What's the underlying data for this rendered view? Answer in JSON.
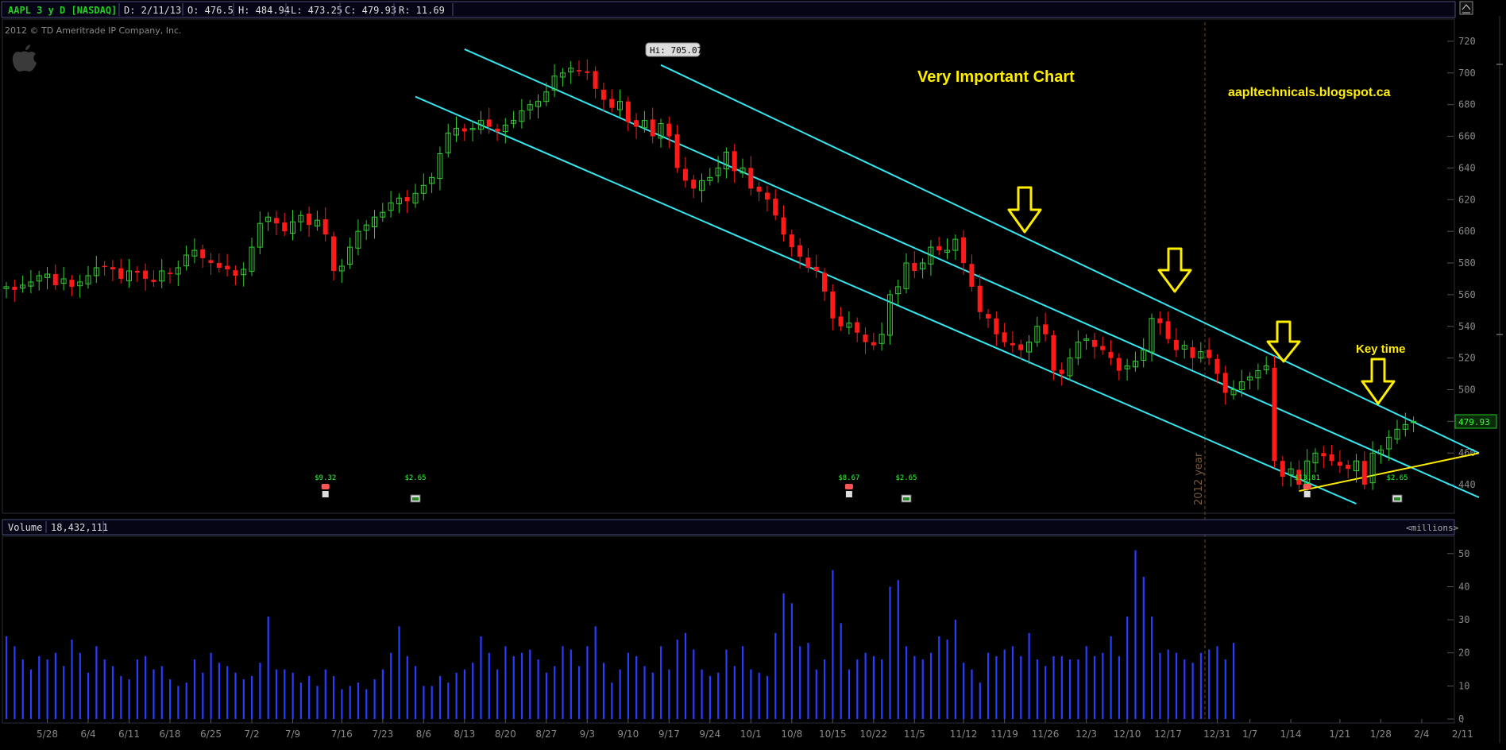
{
  "header": {
    "symbol": "AAPL 3 y D [NASDAQ]",
    "date": "D: 2/11/13",
    "open": "O: 476.5",
    "high": "H: 484.94",
    "low": "L: 473.25",
    "close": "C: 479.93",
    "range": "R: 11.69"
  },
  "copyright": "2012 © TD Ameritrade IP Company, Inc.",
  "annotations": {
    "title": "Very Important Chart",
    "blog": "aapltechnicals.blogspot.ca",
    "key_time": "Key time",
    "hi_label": "Hi: 705.07",
    "year_label": "2012 year",
    "last_price": "479.93"
  },
  "volume_header": {
    "label": "Volume",
    "value": "18,432,111",
    "units": "<millions>"
  },
  "events": [
    {
      "label": "$9.32",
      "icon": "earnings-phone-icon",
      "date_index": 39
    },
    {
      "label": "$2.65",
      "icon": "dividend-icon",
      "date_index": 50
    },
    {
      "label": "$8.67",
      "icon": "earnings-phone-icon",
      "date_index": 103
    },
    {
      "label": "$2.65",
      "icon": "dividend-icon",
      "date_index": 110
    },
    {
      "label": "$13.81",
      "icon": "earnings-phone-icon",
      "date_index": 159
    },
    {
      "label": "$2.65",
      "icon": "dividend-icon",
      "date_index": 170
    }
  ],
  "colors": {
    "up": "#33cc33",
    "down": "#ff1a1a",
    "channel": "#33e6f0",
    "trendline": "#ffee00",
    "arrow": "#ffee00",
    "volume": "#2a3cff",
    "grid_text": "#888888",
    "header_green": "#22cc22"
  },
  "chart_data": {
    "type": "candlestick",
    "price_axis": {
      "min": 425,
      "max": 730,
      "ticks": [
        440,
        460,
        480,
        500,
        520,
        540,
        560,
        580,
        600,
        620,
        640,
        660,
        680,
        700,
        720
      ]
    },
    "volume_axis": {
      "min": 0,
      "max": 55,
      "ticks": [
        0,
        10,
        20,
        30,
        40,
        50
      ]
    },
    "x_tick_labels": [
      "5/28",
      "6/4",
      "6/11",
      "6/18",
      "6/25",
      "7/2",
      "7/9",
      "7/16",
      "7/23",
      "8/6",
      "8/13",
      "8/20",
      "8/27",
      "9/3",
      "9/10",
      "9/17",
      "9/24",
      "10/1",
      "10/8",
      "10/15",
      "10/22",
      "11/5",
      "11/12",
      "11/19",
      "11/26",
      "12/3",
      "12/10",
      "12/17",
      "12/31",
      "1/7",
      "1/14",
      "1/21",
      "1/28",
      "2/4",
      "2/11"
    ],
    "x_tick_index": [
      5,
      10,
      15,
      20,
      25,
      30,
      35,
      41,
      46,
      51,
      56,
      61,
      66,
      71,
      76,
      81,
      86,
      91,
      96,
      101,
      106,
      111,
      117,
      122,
      127,
      132,
      137,
      142,
      148,
      152,
      157,
      163,
      168,
      173,
      178
    ],
    "series": [
      {
        "name": "AAPL",
        "values": [
          565,
          563,
          566,
          568,
          572,
          573,
          566,
          570,
          565,
          568,
          572,
          577,
          578,
          576,
          570,
          575,
          574,
          570,
          568,
          575,
          573,
          577,
          585,
          588,
          583,
          580,
          577,
          576,
          572,
          576,
          590,
          605,
          609,
          605,
          600,
          606,
          610,
          604,
          607,
          598,
          575,
          578,
          590,
          600,
          604,
          609,
          612,
          618,
          621,
          619,
          624,
          629,
          634,
          649,
          662,
          665,
          663,
          665,
          670,
          666,
          663,
          667,
          670,
          676,
          680,
          682,
          688,
          698,
          700,
          703,
          701,
          700,
          690,
          683,
          678,
          682,
          669,
          666,
          670,
          660,
          668,
          660,
          640,
          632,
          627,
          632,
          634,
          640,
          650,
          638,
          640,
          627,
          625,
          620,
          610,
          598,
          590,
          584,
          577,
          575,
          562,
          545,
          540,
          542,
          536,
          530,
          528,
          535,
          560,
          565,
          580,
          575,
          580,
          590,
          588,
          588,
          595,
          580,
          565,
          549,
          545,
          535,
          530,
          528,
          525,
          530,
          540,
          535,
          512,
          510,
          520,
          530,
          532,
          527,
          525,
          520,
          512,
          515,
          518,
          525,
          545,
          542,
          532,
          525,
          528,
          520,
          524,
          520,
          510,
          498,
          500,
          505,
          508,
          512,
          515,
          455,
          445,
          450,
          440,
          455,
          460,
          458,
          455,
          452,
          450,
          455,
          440,
          460,
          462,
          470,
          475,
          478,
          480
        ],
        "volume": [
          25,
          22,
          18,
          15,
          19,
          18,
          20,
          16,
          24,
          20,
          14,
          22,
          18,
          16,
          13,
          12,
          18,
          19,
          15,
          16,
          12,
          10,
          11,
          18,
          14,
          20,
          17,
          16,
          14,
          12,
          13,
          17,
          31,
          15,
          15,
          14,
          11,
          13,
          10,
          15,
          13,
          9,
          10,
          11,
          9,
          12,
          15,
          20,
          28,
          19,
          16,
          10,
          10,
          13,
          11,
          14,
          15,
          17,
          25,
          20,
          15,
          22,
          19,
          20,
          21,
          18,
          14,
          16,
          22,
          21,
          16,
          22,
          28,
          17,
          11,
          15,
          20,
          19,
          16,
          14,
          22,
          15,
          24,
          26,
          21,
          15,
          13,
          14,
          21,
          16,
          22,
          15,
          14,
          13,
          26,
          38,
          35,
          22,
          23,
          15,
          18,
          45,
          29,
          15,
          18,
          20,
          19,
          18,
          40,
          42,
          22,
          19,
          18,
          20,
          25,
          24,
          30,
          17,
          15,
          11,
          20,
          19,
          21,
          22,
          19,
          26,
          18,
          16,
          19,
          19,
          18,
          18,
          22,
          19,
          20,
          25,
          19,
          31,
          51,
          43,
          31,
          20,
          21,
          20,
          18,
          17,
          20,
          21,
          22,
          18,
          23
        ]
      }
    ],
    "overlays": [
      {
        "name": "channel_upper",
        "from": {
          "index": 80,
          "value": 705
        },
        "to": {
          "index": 180,
          "value": 460
        }
      },
      {
        "name": "channel_middle",
        "from": {
          "index": 56,
          "value": 715
        },
        "to": {
          "index": 180,
          "value": 432
        }
      },
      {
        "name": "channel_lower",
        "from": {
          "index": 50,
          "value": 685
        },
        "to": {
          "index": 165,
          "value": 428
        }
      },
      {
        "name": "support_line",
        "from": {
          "index": 158,
          "value": 436
        },
        "to": {
          "index": 180,
          "value": 460
        }
      }
    ]
  }
}
